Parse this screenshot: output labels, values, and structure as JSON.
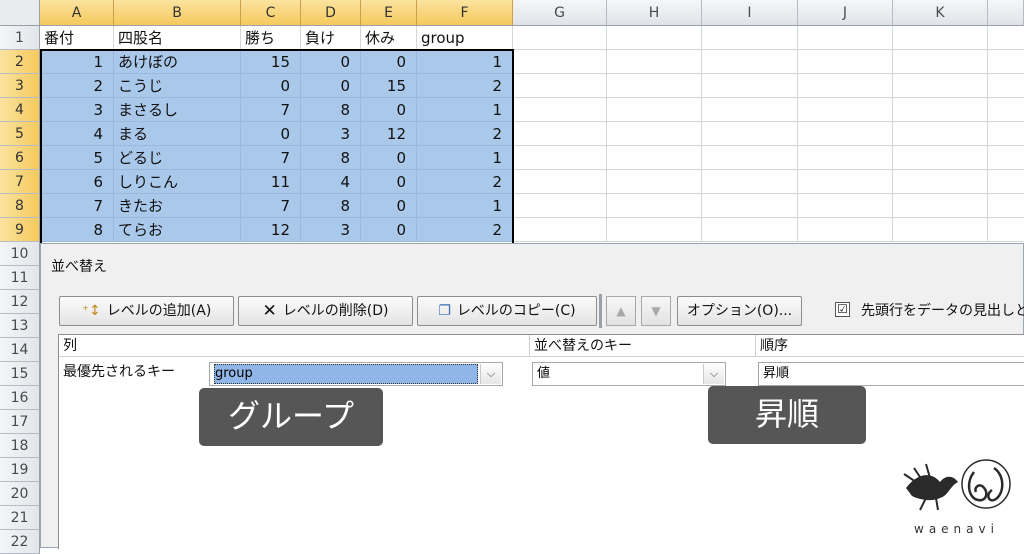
{
  "columns": [
    "A",
    "B",
    "C",
    "D",
    "E",
    "F",
    "G",
    "H",
    "I",
    "J",
    "K"
  ],
  "rows": [
    "1",
    "2",
    "3",
    "4",
    "5",
    "6",
    "7",
    "8",
    "9",
    "10",
    "11",
    "12",
    "13",
    "14",
    "15",
    "16",
    "17",
    "18",
    "19",
    "20",
    "21",
    "22"
  ],
  "table": {
    "headers": [
      "番付",
      "四股名",
      "勝ち",
      "負け",
      "休み",
      "group"
    ],
    "data": [
      [
        "1",
        "あけぼの",
        "15",
        "0",
        "0",
        "1"
      ],
      [
        "2",
        "こうじ",
        "0",
        "0",
        "15",
        "2"
      ],
      [
        "3",
        "まさるし",
        "7",
        "8",
        "0",
        "1"
      ],
      [
        "4",
        "まる",
        "0",
        "3",
        "12",
        "2"
      ],
      [
        "5",
        "どるじ",
        "7",
        "8",
        "0",
        "1"
      ],
      [
        "6",
        "しりこん",
        "11",
        "4",
        "0",
        "2"
      ],
      [
        "7",
        "きたお",
        "7",
        "8",
        "0",
        "1"
      ],
      [
        "8",
        "てらお",
        "12",
        "3",
        "0",
        "2"
      ]
    ]
  },
  "dialog": {
    "title": "並べ替え",
    "add_level": "レベルの追加(A)",
    "delete_level": "レベルの削除(D)",
    "copy_level": "レベルのコピー(C)",
    "options": "オプション(O)...",
    "header_checkbox_label": "先頭行をデータの見出しと",
    "header_checked": "☑",
    "col_header_column": "列",
    "col_header_sort_on": "並べ替えのキー",
    "col_header_order": "順序",
    "row_label": "最優先されるキー",
    "column_value": "group",
    "sort_on_value": "値",
    "order_value": "昇順"
  },
  "overlay": {
    "tag_group": "グループ",
    "tag_ascending": "昇順"
  },
  "logo_text": "waenavi",
  "colors": {
    "selection": "#a9c8ea",
    "header_highlight": "#f5c95c",
    "tag_bg": "#484848"
  }
}
